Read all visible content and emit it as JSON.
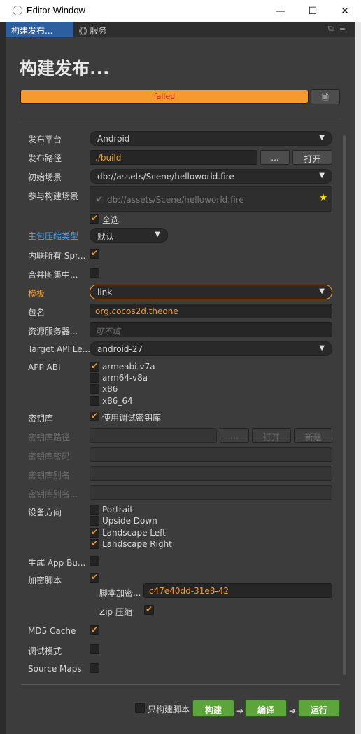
{
  "window": {
    "title": "Editor Window",
    "minimize": "—",
    "maximize": "☐",
    "close": "✕"
  },
  "tabs": {
    "active": "构建发布...",
    "second": "服务"
  },
  "header": {
    "title": "构建发布...",
    "status": "failed",
    "folder_icon": "folder-icon"
  },
  "form": {
    "platform": {
      "label": "发布平台",
      "value": "Android"
    },
    "path": {
      "label": "发布路径",
      "value": "./build",
      "browse": "...",
      "open": "打开"
    },
    "start_scene": {
      "label": "初始场景",
      "value": "db://assets/Scene/helloworld.fire"
    },
    "scenes": {
      "label": "参与构建场景",
      "item": "db://assets/Scene/helloworld.fire",
      "select_all": "全选"
    },
    "compress": {
      "label": "主包压缩类型",
      "value": "默认"
    },
    "inline_sprite": {
      "label": "内联所有 Spr..."
    },
    "merge_atlas": {
      "label": "合并图集中..."
    },
    "template": {
      "label": "模板",
      "value": "link"
    },
    "package": {
      "label": "包名",
      "value": "org.cocos2d.theone"
    },
    "resource_server": {
      "label": "资源服务器...",
      "placeholder": "可不填"
    },
    "target_api": {
      "label": "Target API Le...",
      "value": "android-27"
    },
    "app_abi": {
      "label": "APP ABI",
      "options": [
        "armeabi-v7a",
        "arm64-v8a",
        "x86",
        "x86_64"
      ]
    },
    "keystore": {
      "label": "密钥库",
      "debug": "使用调试密钥库"
    },
    "keystore_path": {
      "label": "密钥库路径",
      "browse": "...",
      "open": "打开",
      "new": "新建"
    },
    "keystore_password": {
      "label": "密钥库密码"
    },
    "keystore_alias": {
      "label": "密钥库别名"
    },
    "keystore_alias_password": {
      "label": "密钥库别名..."
    },
    "orientation": {
      "label": "设备方向",
      "options": [
        "Portrait",
        "Upside Down",
        "Landscape Left",
        "Landscape Right"
      ]
    },
    "app_bundle": {
      "label": "生成 App Bu..."
    },
    "encrypt": {
      "label": "加密脚本",
      "key_label": "脚本加密...",
      "key_value": "c47e40dd-31e8-42",
      "zip_label": "Zip 压缩"
    },
    "md5": {
      "label": "MD5 Cache"
    },
    "debug": {
      "label": "调试模式"
    },
    "sourcemaps": {
      "label": "Source Maps"
    }
  },
  "footer": {
    "only_scripts": "只构建脚本",
    "build": "构建",
    "compile": "编译",
    "run": "运行"
  }
}
